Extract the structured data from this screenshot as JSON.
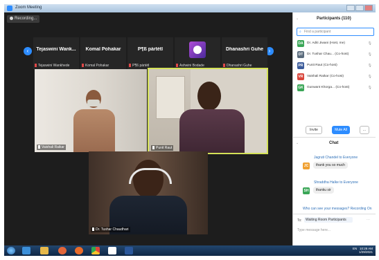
{
  "window": {
    "title": "Zoom Meeting"
  },
  "recording": {
    "label": "Recording..."
  },
  "strip": {
    "participants": [
      {
        "name": "Tejaswini Wank...",
        "label": "Tejaswini Wankhede"
      },
      {
        "name": "Komal Pohakar",
        "label": "Komal Pohakar"
      },
      {
        "name": "P¶ß pártétl",
        "label": "P¶ß pártétl"
      },
      {
        "name": "",
        "label": "Ashwini Bodade"
      },
      {
        "name": "Dhanashri Guhe",
        "label": "Dhanashri Guhe"
      }
    ]
  },
  "videos": {
    "left": {
      "label": "Vaishali Raikar"
    },
    "center": {
      "label": "Punit Raut"
    },
    "bottom": {
      "label": "Dr. Tushar Chaudhari"
    }
  },
  "panel": {
    "participants_title": "Participants (110)",
    "find_placeholder": "Find a participant",
    "participants": [
      {
        "initials": "DA",
        "name": "Dr. Aditi Jiwani (Host, me)",
        "color": "#3aa657"
      },
      {
        "initials": "DT",
        "name": "Dr. Tushar Chau... (Co-host)",
        "color": "#5a6b7c"
      },
      {
        "initials": "PR",
        "name": "Punit Raut (Co-host)",
        "color": "#3b5b9a"
      },
      {
        "initials": "VR",
        "name": "Vaishali Raikar (Co-host)",
        "color": "#d9453b"
      },
      {
        "initials": "GK",
        "name": "Gunwant Khorga... (Co-host)",
        "color": "#3aa657"
      }
    ],
    "invite_label": "Invite",
    "mute_all_label": "Mute All",
    "more_label": "...",
    "chat_title": "Chat",
    "messages": [
      {
        "from": "Jagruti Chandel to Everyone",
        "text": "thank you so much",
        "initials": "JC",
        "color": "#f0a030"
      },
      {
        "from": "Shraddha Halke to Everyone",
        "text": "thanku sir",
        "initials": "SH",
        "color": "#3aa657"
      }
    ],
    "notice": "Who can see your messages? Recording On",
    "to_label": "To:",
    "to_value": "Waiting Room Participants",
    "input_placeholder": "Type message here..."
  },
  "taskbar": {
    "time": "10:28 AM",
    "date": "1/29/2021",
    "lang": "EN"
  },
  "colors": {
    "accent": "#2d8cff",
    "speaker_border": "#d4e157"
  }
}
